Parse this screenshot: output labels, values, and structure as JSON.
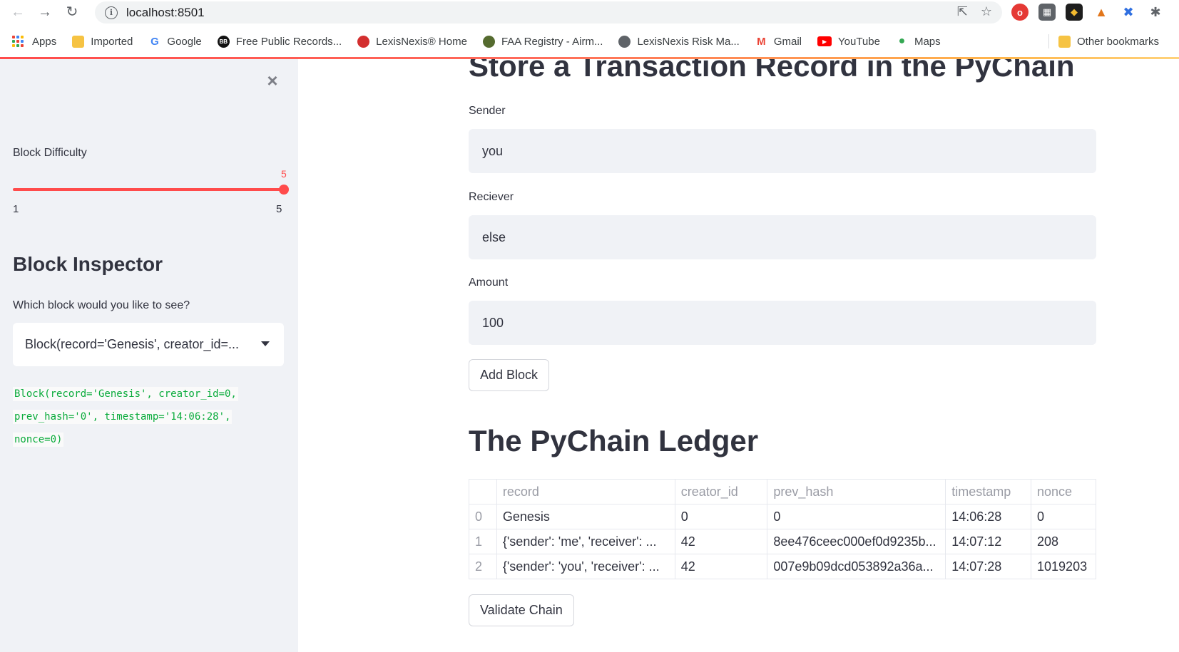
{
  "browser": {
    "url": "localhost:8501",
    "bookmarks": [
      {
        "label": "Apps",
        "icon": "apps-grid-icon"
      },
      {
        "label": "Imported",
        "icon": "folder-icon"
      },
      {
        "label": "Google",
        "icon": "google-icon"
      },
      {
        "label": "Free Public Records...",
        "icon": "bb-icon"
      },
      {
        "label": "LexisNexis® Home",
        "icon": "lexisnexis-icon"
      },
      {
        "label": "FAA Registry - Airm...",
        "icon": "faa-icon"
      },
      {
        "label": "LexisNexis Risk Ma...",
        "icon": "globe-icon"
      },
      {
        "label": "Gmail",
        "icon": "gmail-icon"
      },
      {
        "label": "YouTube",
        "icon": "youtube-icon"
      },
      {
        "label": "Maps",
        "icon": "maps-icon"
      }
    ],
    "other_bookmarks": "Other bookmarks"
  },
  "sidebar": {
    "difficulty_label": "Block Difficulty",
    "slider": {
      "value": "5",
      "min": "1",
      "max": "5",
      "fraction": 1.0
    },
    "inspector_title": "Block Inspector",
    "inspector_question": "Which block would you like to see?",
    "selected_block": "Block(record='Genesis', creator_id=...",
    "code_lines": [
      "Block(record='Genesis', creator_id=0,",
      "prev_hash='0', timestamp='14:06:28',",
      "nonce=0)"
    ]
  },
  "main": {
    "title": "Store a Transaction Record in the PyChain",
    "sender_label": "Sender",
    "sender_value": "you",
    "receiver_label": "Reciever",
    "receiver_value": "else",
    "amount_label": "Amount",
    "amount_value": "100",
    "add_block_label": "Add Block",
    "ledger_title": "The PyChain Ledger",
    "validate_label": "Validate Chain",
    "table": {
      "columns": [
        "",
        "record",
        "creator_id",
        "prev_hash",
        "timestamp",
        "nonce"
      ],
      "rows": [
        [
          "0",
          "Genesis",
          "0",
          "0",
          "14:06:28",
          "0"
        ],
        [
          "1",
          "{'sender': 'me', 'receiver': ...",
          "42",
          "8ee476ceec000ef0d9235b...",
          "14:07:12",
          "208"
        ],
        [
          "2",
          "{'sender': 'you', 'receiver': ...",
          "42",
          "007e9b09dcd053892a36a...",
          "14:07:28",
          "1019203"
        ]
      ]
    }
  },
  "colors": {
    "accent": "#ff4b4b",
    "sidebar_bg": "#f0f2f6",
    "code_green": "#09ab3b"
  }
}
